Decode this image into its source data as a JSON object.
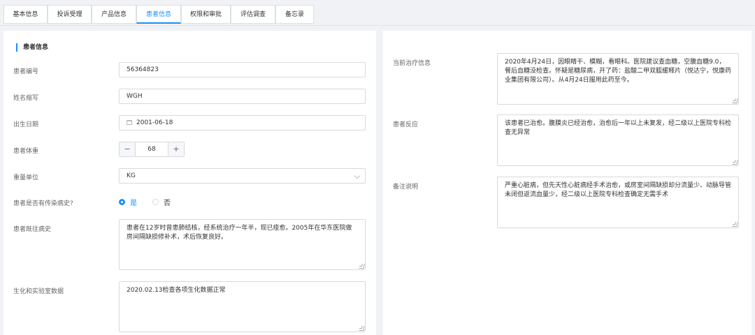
{
  "tabs": [
    {
      "label": "基本信息"
    },
    {
      "label": "投诉受理"
    },
    {
      "label": "产品信息"
    },
    {
      "label": "患者信息",
      "active": true
    },
    {
      "label": "权限和审批"
    },
    {
      "label": "评估调查"
    },
    {
      "label": "备忘录"
    }
  ],
  "accent_color": "#1890ff",
  "patient": {
    "section_title": "患者信息",
    "id_label": "患者编号",
    "id_value": "56364823",
    "initials_label": "姓名缩写",
    "initials_value": "WGH",
    "dob_label": "出生日期",
    "dob_value": "2001-06-18",
    "weight_label": "患者体重",
    "weight_value": "68",
    "weight_minus": "−",
    "weight_plus": "+",
    "unit_label": "重量单位",
    "unit_value": "KG",
    "infectious_label": "患者是否有传染病史?",
    "infectious_yes": "是",
    "infectious_no": "否",
    "infectious_selected": "是",
    "history_label": "患者既往病史",
    "history_value": "患者在12岁时曾患肺结核，经系统治疗一年半，现已痊愈。2005年在华东医院做房间隔缺损修补术，术后恢复良好。",
    "lab_label": "生化和实验室数据",
    "lab_value": "2020.02.13检查各项生化数据正常"
  },
  "right": {
    "treatment_label": "当前治疗信息",
    "treatment_value": "2020年4月24日，因眼睛干、模糊，看眼科。医院建议查血糖，空腹血糖9.0，餐后血糖没检查。怀疑是糖尿病，开了药：盐酸二甲双胍缓释片（悦达宁，悦康药业集团有限公司）。从4月24日服用此药至今。",
    "reaction_label": "患者反应",
    "reaction_value": "该患者已治愈。腹膜炎已经治愈，治愈后一年以上未复发，经二级以上医院专科检查无异常",
    "remarks_label": "备注说明",
    "remarks_value": "严重心脏病，但先天性心脏病经手术治愈，或房室间隔缺损却分流量少、动脉导管未闭但返流血量少，经二级以上医院专科检查确定无需手术"
  }
}
